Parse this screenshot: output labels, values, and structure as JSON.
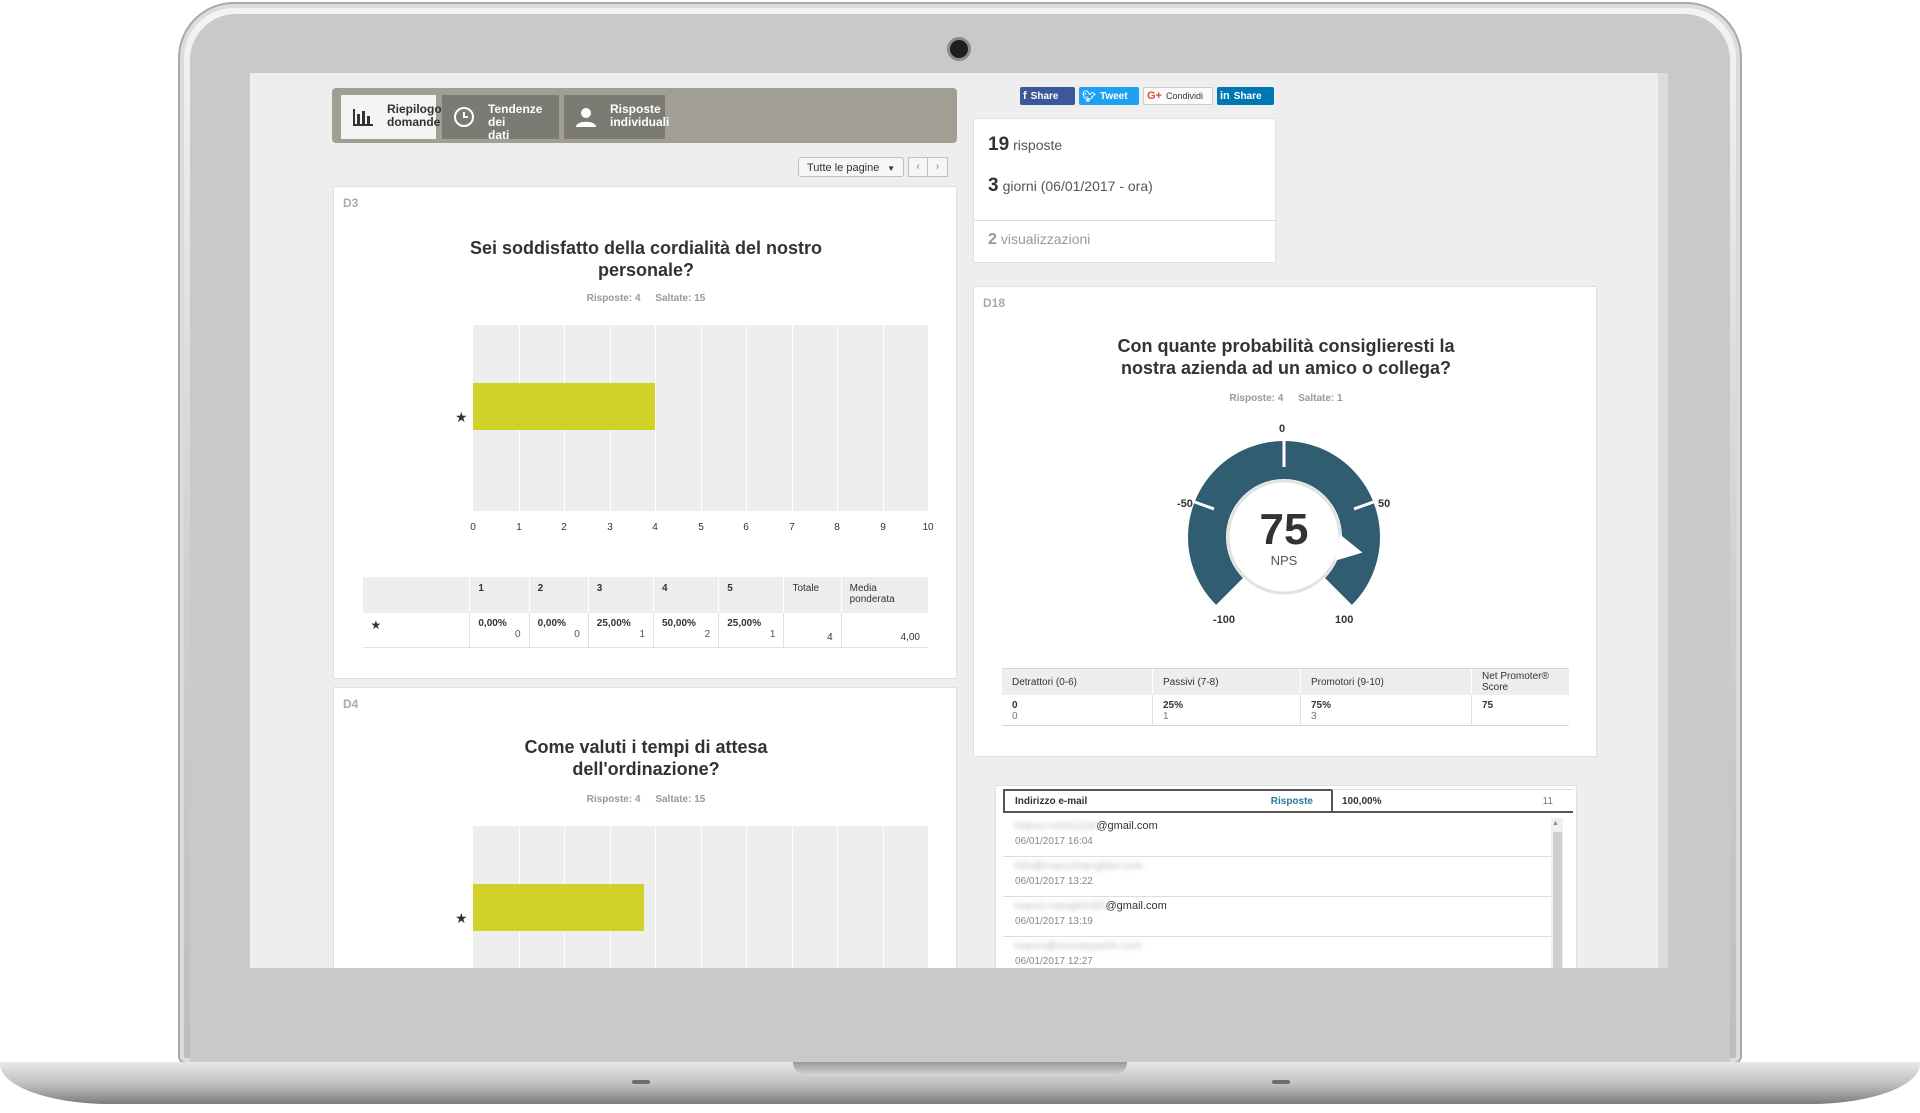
{
  "tabs": [
    {
      "label_line1": "Riepilogo",
      "label_line2": "domande",
      "icon": "bar-chart-icon",
      "active": true
    },
    {
      "label_line1": "Tendenze dei",
      "label_line2": "dati",
      "icon": "clock-icon",
      "active": false
    },
    {
      "label_line1": "Risposte",
      "label_line2": "individuali",
      "icon": "user-icon",
      "active": false
    }
  ],
  "pager": {
    "select_value": "Tutte le pagine",
    "prev": "‹",
    "next": "›"
  },
  "social": {
    "facebook": "Share",
    "twitter": "Tweet",
    "google": "Condividi",
    "linkedin": "Share"
  },
  "summary": {
    "responses_count": "19",
    "responses_label": "risposte",
    "days_count": "3",
    "days_label": "giorni (06/01/2017 - ora)",
    "views_count": "2",
    "views_label": "visualizzazioni"
  },
  "q3": {
    "id": "D3",
    "title_line1": "Sei soddisfatto della cordialità del nostro",
    "title_line2": "personale?",
    "answered": "Risposte: 4",
    "skipped": "Saltate: 15",
    "table": {
      "headers": [
        "1",
        "2",
        "3",
        "4",
        "5",
        "Totale",
        "Media ponderata"
      ],
      "row_label": "★",
      "cells": [
        {
          "pct": "0,00%",
          "count": "0"
        },
        {
          "pct": "0,00%",
          "count": "0"
        },
        {
          "pct": "25,00%",
          "count": "1"
        },
        {
          "pct": "50,00%",
          "count": "2"
        },
        {
          "pct": "25,00%",
          "count": "1"
        }
      ],
      "total": "4",
      "weighted_avg": "4,00"
    }
  },
  "q4": {
    "id": "D4",
    "title_line1": "Come valuti i tempi di attesa",
    "title_line2": "dell'ordinazione?",
    "answered": "Risposte: 4",
    "skipped": "Saltate: 15"
  },
  "q18": {
    "id": "D18",
    "title_line1": "Con quante probabilità consiglieresti la",
    "title_line2": "nostra azienda ad un amico o collega?",
    "answered": "Risposte: 4",
    "skipped": "Saltate: 1",
    "gauge": {
      "value": "75",
      "caption": "NPS",
      "label_top": "0",
      "label_left": "-50",
      "label_right": "50",
      "label_bottom_left": "-100",
      "label_bottom_right": "100",
      "color": "#305d71"
    },
    "table": {
      "headers": [
        "Detrattori (0-6)",
        "Passivi (7-8)",
        "Promotori (9-10)",
        "Net Promoter® Score"
      ],
      "cells": [
        {
          "v": "0",
          "c": "0"
        },
        {
          "v": "25%",
          "c": "1"
        },
        {
          "v": "75%",
          "c": "3"
        },
        {
          "v": "75",
          "c": ""
        }
      ]
    }
  },
  "chart_data": [
    {
      "type": "bar",
      "orientation": "horizontal",
      "categories": [
        "★"
      ],
      "values": [
        4
      ],
      "xlim": [
        0,
        10
      ],
      "xticks": [
        "0",
        "1",
        "2",
        "3",
        "4",
        "5",
        "6",
        "7",
        "8",
        "9",
        "10"
      ],
      "color": "#d0d228",
      "grid": true
    },
    {
      "type": "bar",
      "orientation": "horizontal",
      "categories": [
        "★"
      ],
      "values": [
        3.75
      ],
      "xlim": [
        0,
        10
      ],
      "color": "#d0d228",
      "grid": true
    }
  ],
  "email": {
    "header_label": "Indirizzo e-mail",
    "header_link": "Risposte",
    "pct": "100,00%",
    "count": "11",
    "rows": [
      {
        "hidden": "marco.rossi1234",
        "visible": "@gmail.com",
        "time": "06/01/2017 16:04"
      },
      {
        "hidden": "info@marcomenghini.com",
        "visible": "",
        "time": "06/01/2017 13:22"
      },
      {
        "hidden": "marco.menghini90",
        "visible": "@gmail.com",
        "time": "06/01/2017 13:19"
      },
      {
        "hidden": "marco@ssurveywork.com",
        "visible": "",
        "time": "06/01/2017 12:27"
      }
    ]
  }
}
